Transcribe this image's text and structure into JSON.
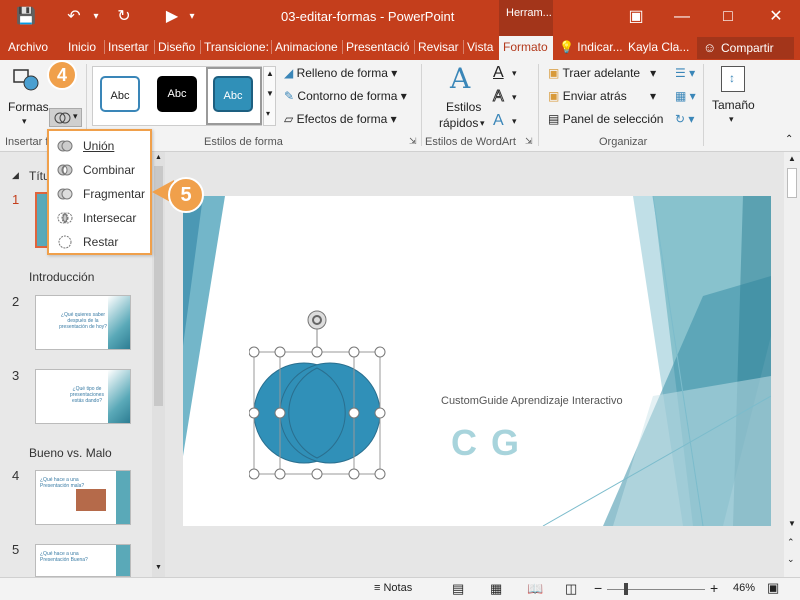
{
  "titlebar": {
    "title": "03-editar-formas  -  PowerPoint",
    "tools_context": "Herram..."
  },
  "tabs": {
    "archivo": "Archivo",
    "inicio": "Inicio",
    "insertar": "Insertar",
    "diseno": "Diseño",
    "transiciones": "Transicione:",
    "animaciones": "Animacione",
    "presentacion": "Presentació",
    "revisar": "Revisar",
    "vista": "Vista",
    "formato": "Formato",
    "indicar": "Indicar...",
    "user": "Kayla Cla...",
    "compartir": "Compartir"
  },
  "ribbon": {
    "formas": "Formas",
    "insertar_group": "Insertar f",
    "styles": [
      "Abc",
      "Abc",
      "Abc"
    ],
    "relleno": "Relleno de forma",
    "contorno": "Contorno de forma",
    "efectos": "Efectos de forma",
    "estilos_forma_group": "Estilos de forma",
    "estilos_rapidos_1": "Estilos",
    "estilos_rapidos_2": "rápidos",
    "wordart_group": "Estilos de WordArt",
    "traer": "Traer adelante",
    "enviar": "Enviar atrás",
    "panel": "Panel de selección",
    "organizar_group": "Organizar",
    "tamano": "Tamaño"
  },
  "merge_menu": {
    "items": [
      "Unión",
      "Combinar",
      "Fragmentar",
      "Intersecar",
      "Restar"
    ]
  },
  "callouts": {
    "step4": "4",
    "step5": "5"
  },
  "slides_pane": {
    "sections": [
      "Títu",
      "Introducción",
      "Bueno vs. Malo"
    ],
    "slides": [
      {
        "num": "1"
      },
      {
        "num": "2",
        "text": "¿Qué quieres saber después de la presentación de hoy?"
      },
      {
        "num": "3",
        "text": "¿Qué tipo de presentaciones estás dando?"
      },
      {
        "num": "4",
        "text": "¿Qué hace a una Presentación mala?"
      },
      {
        "num": "5",
        "text": "¿Qué hace a una Presentación Buena?"
      }
    ]
  },
  "slide": {
    "caption": "CustomGuide Aprendizaje Interactivo",
    "logo": "C G"
  },
  "status": {
    "notas": "Notas",
    "zoom": "46%"
  },
  "colors": {
    "accent": "#c43e1c",
    "callout": "#f0a04b",
    "shape": "#3090b8",
    "teal": "#5aa9b8"
  }
}
